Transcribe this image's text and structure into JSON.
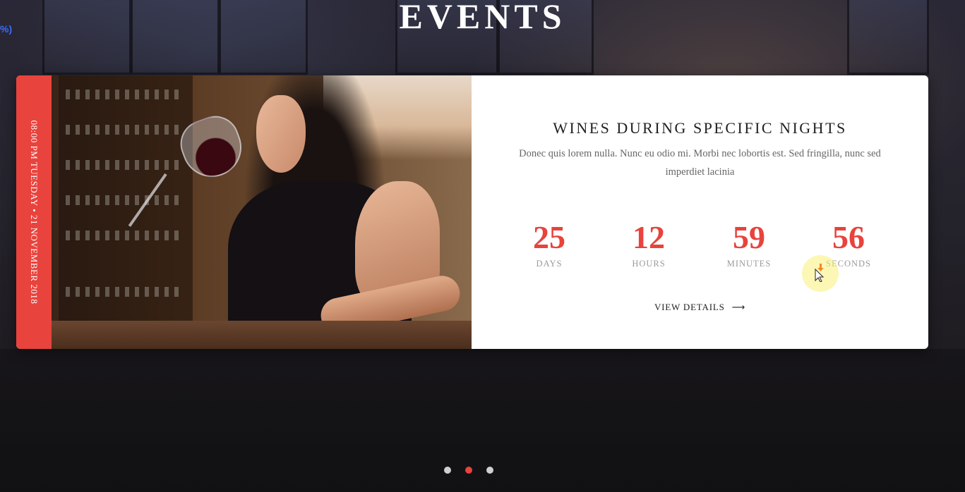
{
  "edge_fragment": "%)",
  "section": {
    "title": "EVENTS"
  },
  "event": {
    "date_line": "08:00 PM TUESDAY • 21 NOVEMBER 2018",
    "title": "WINES DURING SPECIFIC NIGHTS",
    "description": "Donec quis lorem nulla. Nunc eu odio mi. Morbi nec lobortis est. Sed fringilla, nunc sed imperdiet lacinia",
    "countdown": [
      {
        "value": "25",
        "label": "DAYS"
      },
      {
        "value": "12",
        "label": "HOURS"
      },
      {
        "value": "59",
        "label": "MINUTES"
      },
      {
        "value": "56",
        "label": "SECONDS"
      }
    ],
    "view_details_label": "VIEW DETAILS",
    "arrow_icon": "arrow-right-icon"
  },
  "pager": {
    "active_index": 1,
    "count": 3
  },
  "colors": {
    "accent": "#e8433d",
    "dot_inactive": "#cfcfcf"
  }
}
